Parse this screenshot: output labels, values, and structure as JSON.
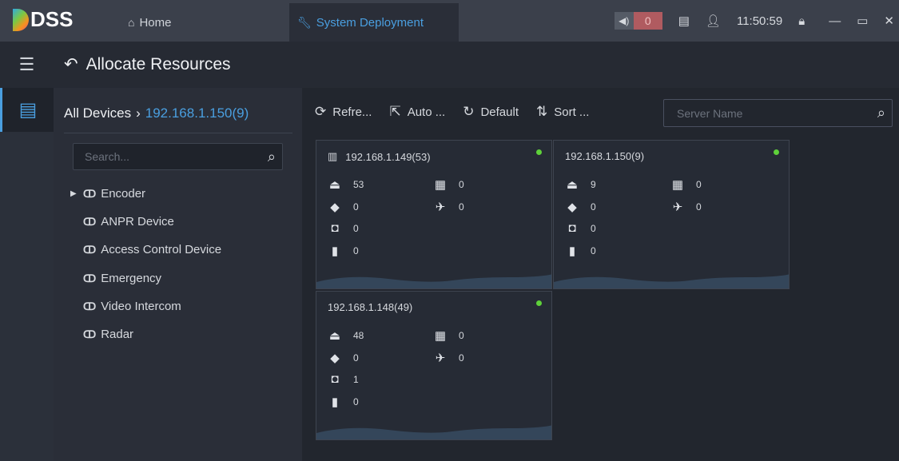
{
  "app": {
    "logo": "DSS",
    "tabs": [
      {
        "label": "Home",
        "icon": "home-icon"
      },
      {
        "label": "System Deployment",
        "icon": "wrench-icon"
      }
    ],
    "alarm_count": "0",
    "time": "11:50:59"
  },
  "page": {
    "title": "Allocate Resources"
  },
  "left": {
    "breadcrumb_root": "All Devices",
    "breadcrumb_current": "192.168.1.150(9)",
    "search_placeholder": "Search...",
    "tree": [
      "Encoder",
      "ANPR Device",
      "Access Control Device",
      "Emergency",
      "Video Intercom",
      "Radar"
    ]
  },
  "toolbar": {
    "refresh": "Refre...",
    "auto": "Auto ...",
    "default": "Default",
    "sort": "Sort ...",
    "server_placeholder": "Server Name"
  },
  "servers": [
    {
      "name": "192.168.1.149(53)",
      "encoder": "53",
      "anpr": "0",
      "access": "0",
      "intercom": "0",
      "emergency": "0",
      "radar": "0"
    },
    {
      "name": "192.168.1.150(9)",
      "encoder": "9",
      "anpr": "0",
      "access": "0",
      "intercom": "0",
      "emergency": "0",
      "radar": "0"
    },
    {
      "name": "192.168.1.148(49)",
      "encoder": "48",
      "anpr": "0",
      "access": "1",
      "intercom": "0",
      "emergency": "0",
      "radar": "0"
    }
  ],
  "colors": {
    "accent": "#4a9fe0",
    "online": "#5ed13a",
    "alarm": "#b05b60"
  }
}
